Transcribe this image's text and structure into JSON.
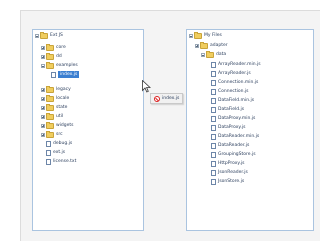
{
  "left_tree": [
    {
      "label": "Ext JS"
    },
    {
      "label": "core"
    },
    {
      "label": "dd"
    },
    {
      "label": "examples"
    },
    {
      "label": "index.js"
    },
    {
      "label": "legacy"
    },
    {
      "label": "locale"
    },
    {
      "label": "state"
    },
    {
      "label": "util"
    },
    {
      "label": "widgets"
    },
    {
      "label": "src"
    },
    {
      "label": "debug.js"
    },
    {
      "label": "ext.js"
    },
    {
      "label": "license.txt"
    }
  ],
  "right_tree": [
    {
      "label": "My Files"
    },
    {
      "label": "adapter"
    },
    {
      "label": "data"
    },
    {
      "label": "ArrayReader.min.js"
    },
    {
      "label": "ArrayReader.js"
    },
    {
      "label": "Connection.min.js"
    },
    {
      "label": "Connection.js"
    },
    {
      "label": "DataField.min.js"
    },
    {
      "label": "DataField.js"
    },
    {
      "label": "DataProxy.min.js"
    },
    {
      "label": "DataProxy.js"
    },
    {
      "label": "DataReader.min.js"
    },
    {
      "label": "DataReader.js"
    },
    {
      "label": "GroupingStore.js"
    },
    {
      "label": "HttpProxy.js"
    },
    {
      "label": "JsonReader.js"
    },
    {
      "label": "JsonStore.js"
    }
  ],
  "drag_proxy": {
    "label": "index.js"
  },
  "colors": {
    "selection": "#3b7fd1",
    "panel_border": "#aac4e0",
    "folder": "#f0cd5e"
  }
}
